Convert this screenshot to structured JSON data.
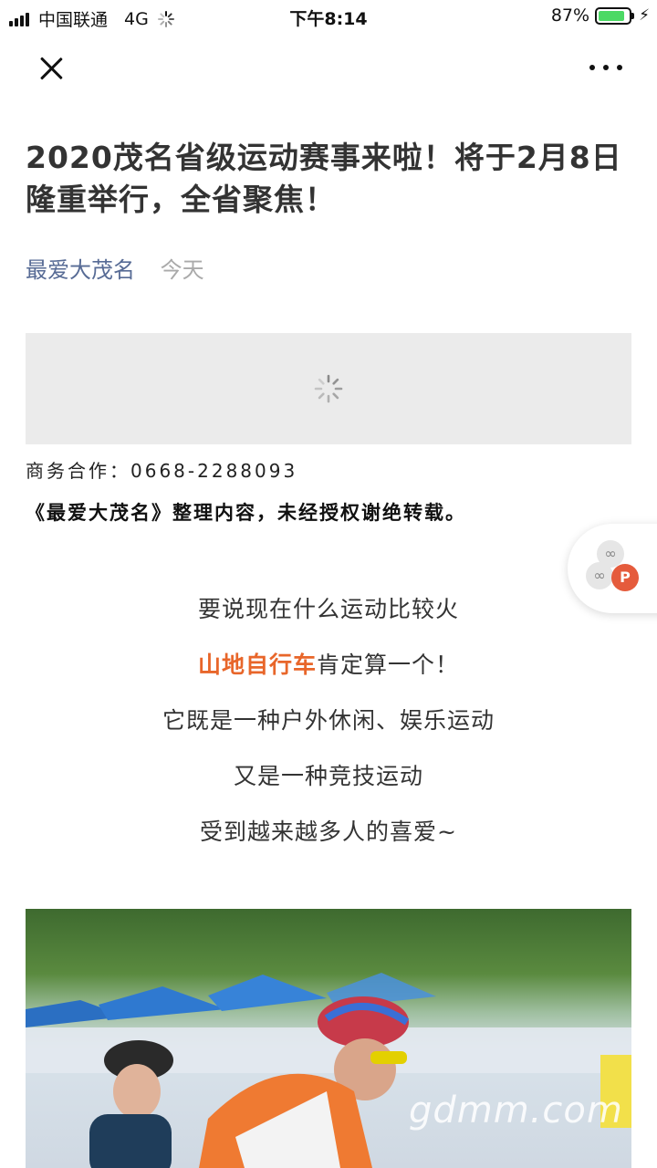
{
  "status_bar": {
    "carrier": "中国联通",
    "network": "4G",
    "time": "下午8:14",
    "battery_percent": "87%",
    "battery_level": 0.87
  },
  "nav": {
    "close_icon": "close-icon",
    "more_icon": "more-icon"
  },
  "article": {
    "title": "2020茂名省级运动赛事来啦！将于2月8日隆重举行，全省聚焦！",
    "author": "最爱大茂名",
    "date": "今天",
    "business_contact": "商务合作：0668-2288093",
    "copyright_notice": "《最爱大茂名》整理内容，未经授权谢绝转载。",
    "body": {
      "line1": "要说现在什么运动比较火",
      "line2_highlight": "山地自行车",
      "line2_rest": "肯定算一个！",
      "line3": "它既是一种户外休闲、娱乐运动",
      "line4": "又是一种竞技运动",
      "line5": "受到越来越多人的喜爱~"
    },
    "watermark": "gdmm.com"
  },
  "floating_widget": {
    "badge": "P"
  },
  "colors": {
    "author": "#576b95",
    "highlight": "#e8662a",
    "badge": "#e55b3c"
  }
}
